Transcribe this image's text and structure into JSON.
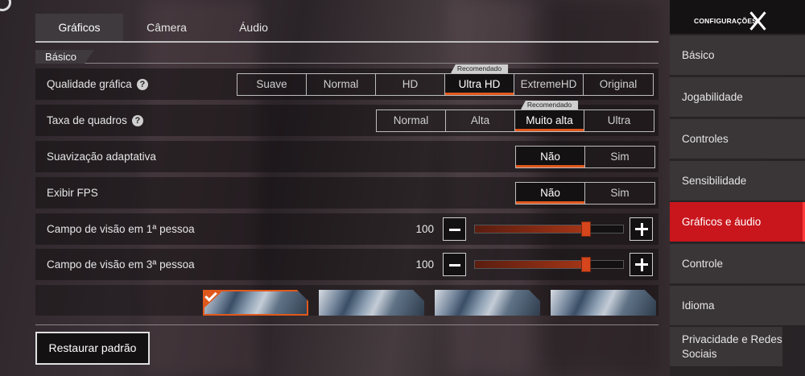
{
  "tabs": [
    {
      "label": "Gráficos",
      "active": true
    },
    {
      "label": "Câmera",
      "active": false
    },
    {
      "label": "Áudio",
      "active": false
    }
  ],
  "section": {
    "title": "Básico"
  },
  "rows": {
    "quality": {
      "label": "Qualidade gráfica",
      "options": [
        "Suave",
        "Normal",
        "HD",
        "Ultra HD",
        "ExtremeHD",
        "Original"
      ],
      "selected": "Ultra HD",
      "recommended_badge": "Recomendado"
    },
    "framerate": {
      "label": "Taxa de quadros",
      "options": [
        "Normal",
        "Alta",
        "Muito alta",
        "Ultra"
      ],
      "selected": "Muito alta",
      "recommended_badge": "Recomendado"
    },
    "smoothing": {
      "label": "Suavização adaptativa",
      "options": [
        "Não",
        "Sim"
      ],
      "selected": "Não"
    },
    "fps": {
      "label": "Exibir FPS",
      "options": [
        "Não",
        "Sim"
      ],
      "selected": "Não"
    },
    "fov1": {
      "label": "Campo de visão em 1ª pessoa",
      "value": "100",
      "fraction": 0.75
    },
    "fov3": {
      "label": "Campo de visão em 3ª pessoa",
      "value": "100",
      "fraction": 0.75
    }
  },
  "previews": {
    "selected_index": 0,
    "count": 4
  },
  "restore_button": "Restaurar padrão",
  "sidebar": {
    "title": "CONFIGURAÇÕES",
    "items": [
      {
        "label": "Básico",
        "active": false
      },
      {
        "label": "Jogabilidade",
        "active": false
      },
      {
        "label": "Controles",
        "active": false
      },
      {
        "label": "Sensibilidade",
        "active": false
      },
      {
        "label": "Gráficos e áudio",
        "active": true
      },
      {
        "label": "Controle",
        "active": false
      },
      {
        "label": "Idioma",
        "active": false
      },
      {
        "label": "Privacidade e Redes Sociais",
        "active": false
      }
    ]
  },
  "colors": {
    "accent": "#e0581c",
    "sidebar_active": "#c9161d"
  }
}
